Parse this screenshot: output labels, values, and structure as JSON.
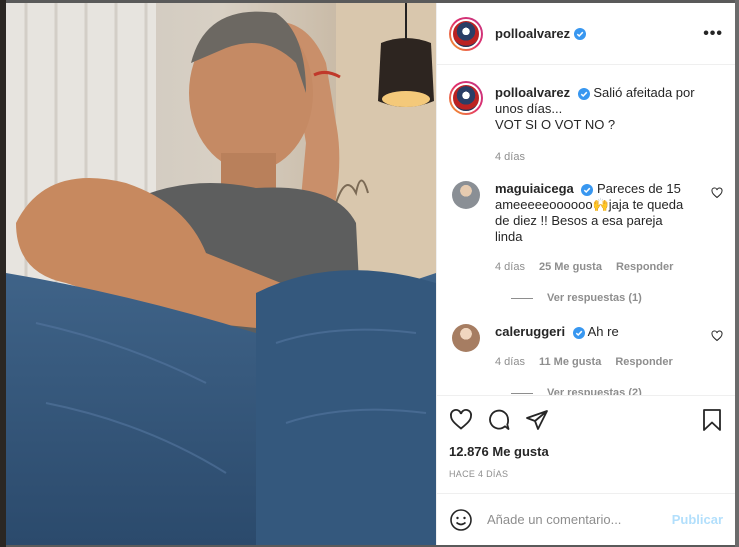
{
  "post": {
    "username": "polloalvarez",
    "more_icon": "more-horizontal-icon",
    "caption_line1": "Salió afeitada por",
    "caption_line2": "unos días...",
    "caption_line3": "VOT SI O VOT NO ?",
    "caption_time": "4 días",
    "likes": "12.876 Me gusta",
    "posted_ago": "HACE 4 DÍAS"
  },
  "comments": [
    {
      "username": "maguiaicega",
      "text_line1": "Pareces de 15",
      "text_line2": "ameeeeeoooooo🙌jaja te queda",
      "text_line3": "de diez !! Besos a esa pareja",
      "text_line4": "linda",
      "time": "4 días",
      "likes": "25 Me gusta",
      "reply": "Responder",
      "view_replies": "Ver respuestas (1)"
    },
    {
      "username": "caleruggeri",
      "text": "Ah re",
      "time": "4 días",
      "likes": "11 Me gusta",
      "reply": "Responder",
      "view_replies": "Ver respuestas (2)"
    }
  ],
  "composer": {
    "placeholder": "Añade un comentario...",
    "publish_label": "Publicar",
    "emoji_icon": "emoji-icon"
  },
  "action_icons": [
    "heart-icon",
    "comment-icon",
    "share-icon",
    "bookmark-icon"
  ],
  "colors": {
    "accent_disabled": "#b2dffc",
    "verified": "#3897f0",
    "secondary_text": "#8e8e8e"
  }
}
